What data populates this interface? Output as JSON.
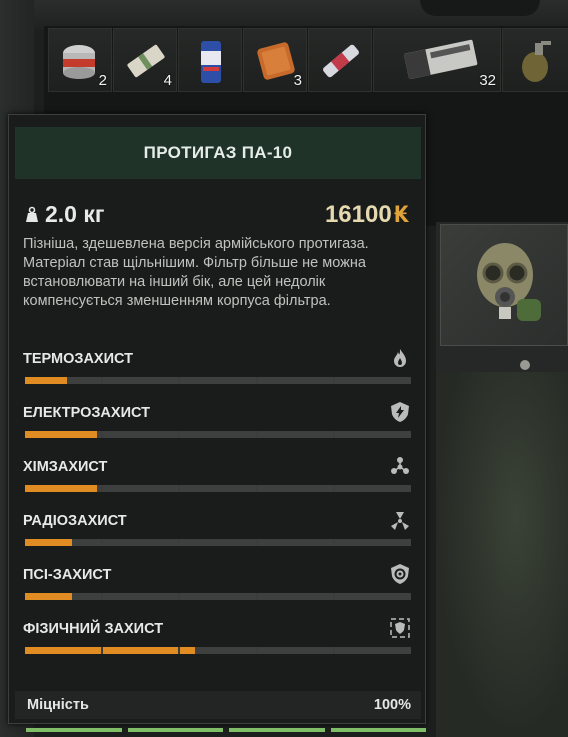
{
  "inventory": {
    "items": [
      {
        "name": "canned-food",
        "qty": "2"
      },
      {
        "name": "bandage",
        "qty": "4"
      },
      {
        "name": "energy-drink",
        "qty": ""
      },
      {
        "name": "bread",
        "qty": "3"
      },
      {
        "name": "antirad-syringe",
        "qty": ""
      },
      {
        "name": "ammo-box",
        "qty": "32"
      },
      {
        "name": "grenade",
        "qty": ""
      }
    ]
  },
  "tooltip": {
    "title": "ПРОТИГАЗ ПА-10",
    "weight": "2.0 кг",
    "price": "16100",
    "currency": "₭",
    "description": "Пізніша, здешевлена версія армійського протигаза. Матеріал став щільнішим. Фільтр більше не можна встановлювати на інший бік, але цей недолік компенсується зменшенням корпуса фільтра.",
    "stats": [
      {
        "label": "ТЕРМОЗАХИСТ",
        "icon": "fire-icon",
        "segments_filled": 0.55
      },
      {
        "label": "ЕЛЕКТРОЗАХИСТ",
        "icon": "electric-shield-icon",
        "segments_filled": 0.95
      },
      {
        "label": "ХІМЗАХИСТ",
        "icon": "chemical-icon",
        "segments_filled": 0.95
      },
      {
        "label": "РАДІОЗАХИСТ",
        "icon": "radiation-icon",
        "segments_filled": 0.62
      },
      {
        "label": "ПСІ-ЗАХИСТ",
        "icon": "psi-shield-icon",
        "segments_filled": 0.62
      },
      {
        "label": "ФІЗИЧНИЙ ЗАХИСТ",
        "icon": "armor-icon",
        "segments_filled": 2.2
      }
    ],
    "durability_label": "Міцність",
    "durability_value": "100%"
  },
  "colors": {
    "accent_orange": "#e08c22",
    "header_green": "#1f3328",
    "durability_green": "#7fbd66",
    "price_gold": "#e0a23a"
  }
}
